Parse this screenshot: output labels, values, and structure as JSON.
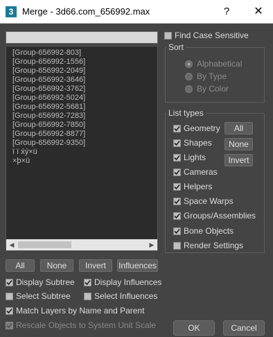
{
  "window": {
    "app_icon_letter": "3",
    "title": "Merge - 3d66.com_656992.max",
    "help_glyph": "?",
    "close_glyph": "✕"
  },
  "search": {
    "value": "",
    "placeholder": ""
  },
  "list": {
    "items": [
      "[Group-656992-803]",
      "[Group-656992-1556]",
      "[Group-656992-2049]",
      "[Group-656992-3646]",
      "[Group-656992-3762]",
      "[Group-656992-5024]",
      "[Group-656992-5681]",
      "[Group-656992-7283]",
      "[Group-656992-7850]",
      "[Group-656992-8877]",
      "[Group-656992-9350]",
      "ï ï x́ý×ü",
      "×þ×ü"
    ]
  },
  "list_buttons": {
    "all": "All",
    "none": "None",
    "invert": "Invert",
    "influences": "Influences"
  },
  "options": {
    "display_subtree": {
      "label": "Display Subtree",
      "checked": true
    },
    "display_influences": {
      "label": "Display Influences",
      "checked": true
    },
    "select_subtree": {
      "label": "Select Subtree",
      "checked": false
    },
    "select_influences": {
      "label": "Select Influences",
      "checked": false
    },
    "match_layers": {
      "label": "Match Layers by Name and Parent",
      "checked": true
    },
    "rescale_objects": {
      "label": "Rescale Objects to System Unit Scale",
      "checked": true,
      "disabled": true
    }
  },
  "find_case_sensitive": {
    "label": "Find Case Sensitive",
    "checked": false
  },
  "sort": {
    "title": "Sort",
    "options": [
      {
        "label": "Alphabetical",
        "checked": true
      },
      {
        "label": "By Type",
        "checked": false
      },
      {
        "label": "By Color",
        "checked": false
      }
    ]
  },
  "list_types": {
    "title": "List types",
    "items": [
      {
        "label": "Geometry",
        "checked": true
      },
      {
        "label": "Shapes",
        "checked": true
      },
      {
        "label": "Lights",
        "checked": true
      },
      {
        "label": "Cameras",
        "checked": true
      },
      {
        "label": "Helpers",
        "checked": true
      },
      {
        "label": "Space Warps",
        "checked": true
      },
      {
        "label": "Groups/Assemblies",
        "checked": true
      },
      {
        "label": "Bone Objects",
        "checked": true
      },
      {
        "label": "Render Settings",
        "checked": false
      }
    ],
    "buttons": {
      "all": "All",
      "none": "None",
      "invert": "Invert"
    }
  },
  "dialog_buttons": {
    "ok": "OK",
    "cancel": "Cancel"
  },
  "colors": {
    "background": "#444444",
    "list_background": "#2b2b2b",
    "titlebar": "#ffffff",
    "app_icon": "#1c7a96"
  }
}
